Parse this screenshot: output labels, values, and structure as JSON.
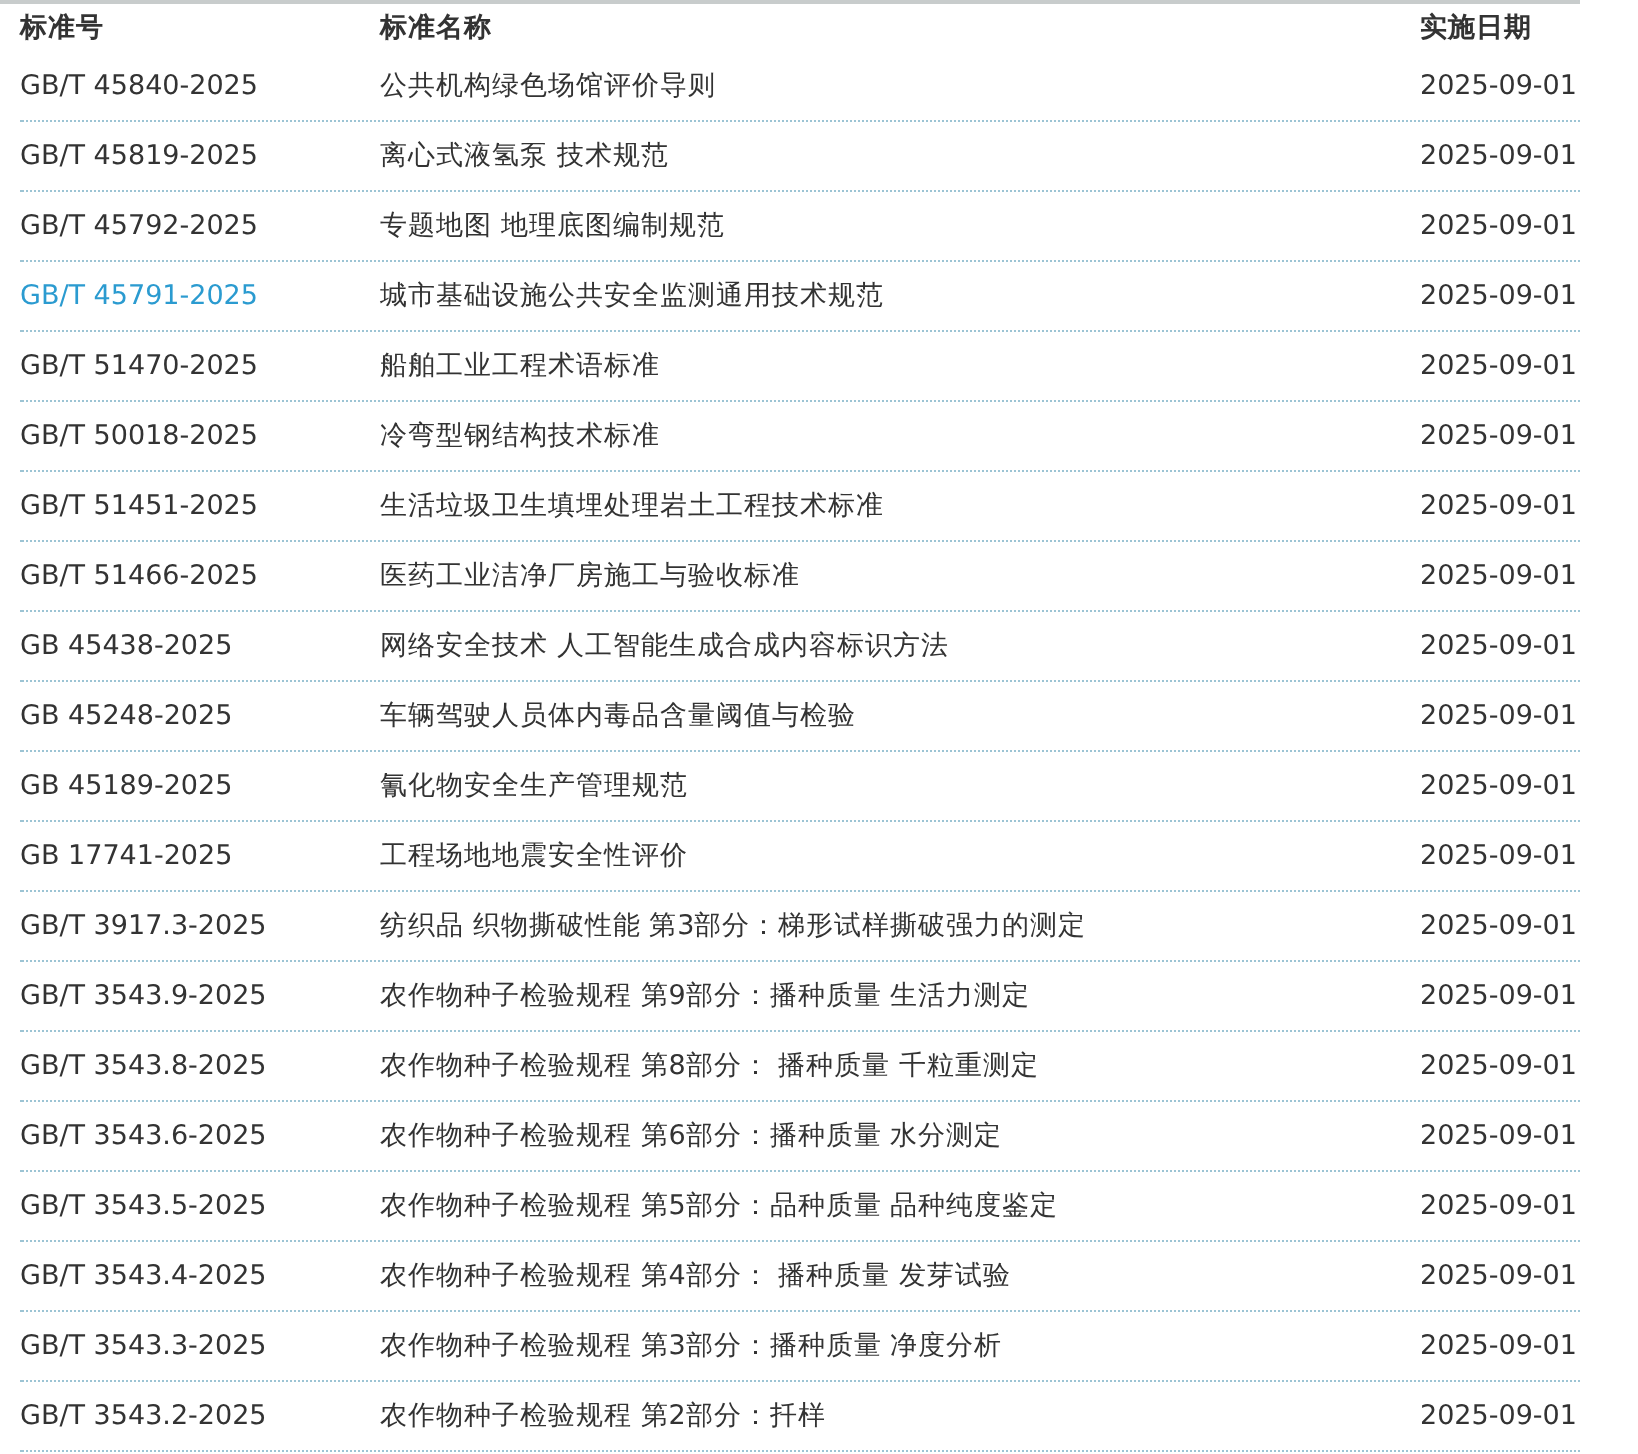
{
  "table": {
    "columns": [
      "标准号",
      "标准名称",
      "实施日期"
    ],
    "rows": [
      {
        "code": "GB/T 45840-2025",
        "name": "公共机构绿色场馆评价导则",
        "date": "2025-09-01",
        "highlighted": false
      },
      {
        "code": "GB/T 45819-2025",
        "name": "离心式液氢泵 技术规范",
        "date": "2025-09-01",
        "highlighted": false
      },
      {
        "code": "GB/T 45792-2025",
        "name": "专题地图 地理底图编制规范",
        "date": "2025-09-01",
        "highlighted": false
      },
      {
        "code": "GB/T 45791-2025",
        "name": "城市基础设施公共安全监测通用技术规范",
        "date": "2025-09-01",
        "highlighted": true
      },
      {
        "code": "GB/T 51470-2025",
        "name": "船舶工业工程术语标准",
        "date": "2025-09-01",
        "highlighted": false
      },
      {
        "code": "GB/T 50018-2025",
        "name": "冷弯型钢结构技术标准",
        "date": "2025-09-01",
        "highlighted": false
      },
      {
        "code": "GB/T 51451-2025",
        "name": "生活垃圾卫生填埋处理岩土工程技术标准",
        "date": "2025-09-01",
        "highlighted": false
      },
      {
        "code": "GB/T 51466-2025",
        "name": "医药工业洁净厂房施工与验收标准",
        "date": "2025-09-01",
        "highlighted": false
      },
      {
        "code": "GB 45438-2025",
        "name": "网络安全技术 人工智能生成合成内容标识方法",
        "date": "2025-09-01",
        "highlighted": false
      },
      {
        "code": "GB 45248-2025",
        "name": "车辆驾驶人员体内毒品含量阈值与检验",
        "date": "2025-09-01",
        "highlighted": false
      },
      {
        "code": "GB 45189-2025",
        "name": "氰化物安全生产管理规范",
        "date": "2025-09-01",
        "highlighted": false
      },
      {
        "code": "GB 17741-2025",
        "name": "工程场地地震安全性评价",
        "date": "2025-09-01",
        "highlighted": false
      },
      {
        "code": "GB/T 3917.3-2025",
        "name": "纺织品 织物撕破性能 第3部分：梯形试样撕破强力的测定",
        "date": "2025-09-01",
        "highlighted": false
      },
      {
        "code": "GB/T 3543.9-2025",
        "name": "农作物种子检验规程 第9部分：播种质量 生活力测定",
        "date": "2025-09-01",
        "highlighted": false
      },
      {
        "code": "GB/T 3543.8-2025",
        "name": "农作物种子检验规程 第8部分： 播种质量 千粒重测定",
        "date": "2025-09-01",
        "highlighted": false
      },
      {
        "code": "GB/T 3543.6-2025",
        "name": "农作物种子检验规程 第6部分：播种质量 水分测定",
        "date": "2025-09-01",
        "highlighted": false
      },
      {
        "code": "GB/T 3543.5-2025",
        "name": "农作物种子检验规程 第5部分：品种质量 品种纯度鉴定",
        "date": "2025-09-01",
        "highlighted": false
      },
      {
        "code": "GB/T 3543.4-2025",
        "name": "农作物种子检验规程 第4部分： 播种质量 发芽试验",
        "date": "2025-09-01",
        "highlighted": false
      },
      {
        "code": "GB/T 3543.3-2025",
        "name": "农作物种子检验规程 第3部分：播种质量 净度分析",
        "date": "2025-09-01",
        "highlighted": false
      },
      {
        "code": "GB/T 3543.2-2025",
        "name": "农作物种子检验规程 第2部分：扦样",
        "date": "2025-09-01",
        "highlighted": false
      }
    ]
  }
}
